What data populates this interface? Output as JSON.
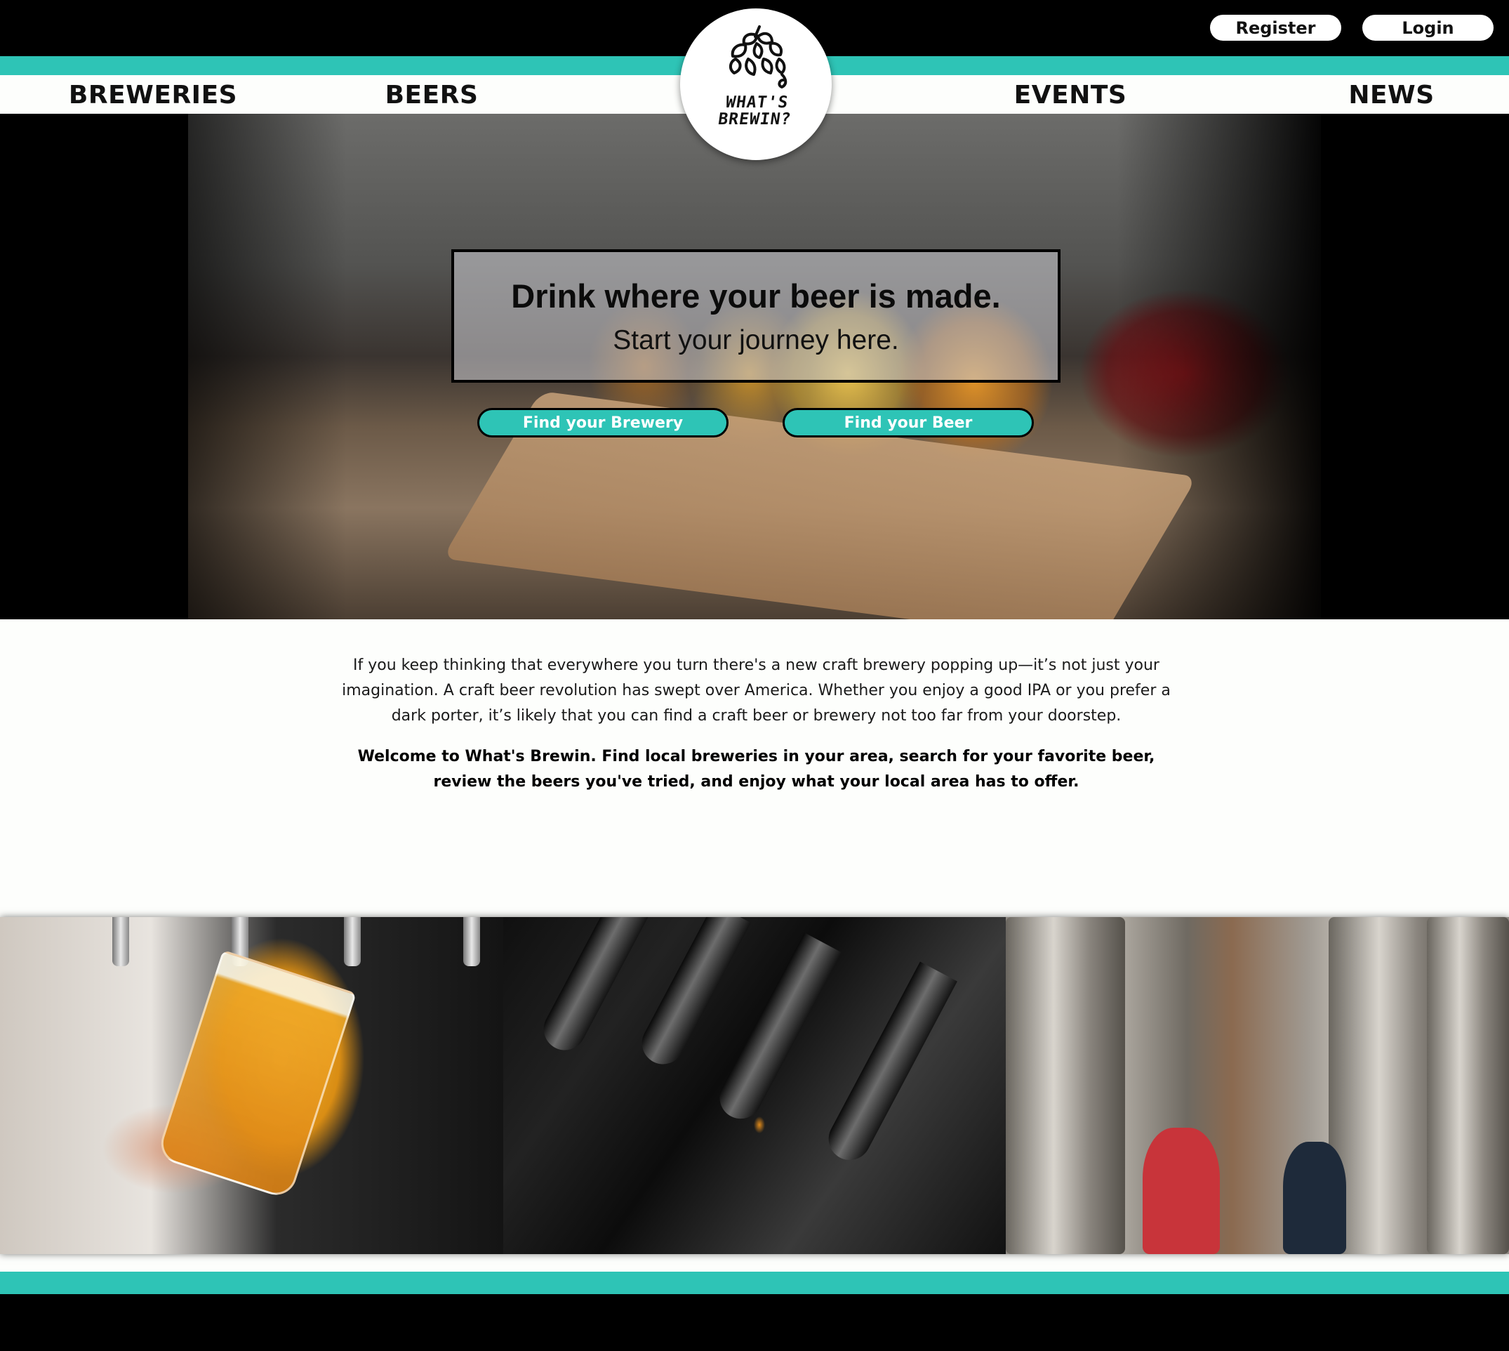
{
  "header": {
    "register_label": "Register",
    "login_label": "Login",
    "logo": {
      "line1": "WHAT'S",
      "line2": "BREWIN?"
    },
    "nav": [
      {
        "label": "BREWERIES"
      },
      {
        "label": "BEERS"
      },
      {
        "label": "EVENTS"
      },
      {
        "label": "NEWS"
      }
    ]
  },
  "hero": {
    "title": "Drink where your beer is made.",
    "subtitle": "Start your journey here.",
    "cta_brewery": "Find your Brewery",
    "cta_beer": "Find your Beer"
  },
  "intro": {
    "paragraph": "If you keep thinking that everywhere you turn there's a new craft brewery popping up—it’s not just your imagination. A craft beer revolution has swept over America. Whether you enjoy a good IPA or you prefer a dark porter, it’s likely that you can find a craft beer or brewery not too far from your doorstep.",
    "welcome": "Welcome to What's Brewin. Find local breweries in your area, search for your favorite beer, review the beers you've tried, and enjoy what your local area has to offer."
  },
  "icons": {
    "logo": "hop-icon"
  },
  "colors": {
    "accent": "#2ec4b6",
    "header_bg": "#000000",
    "nav_bg": "#fdfefc"
  }
}
